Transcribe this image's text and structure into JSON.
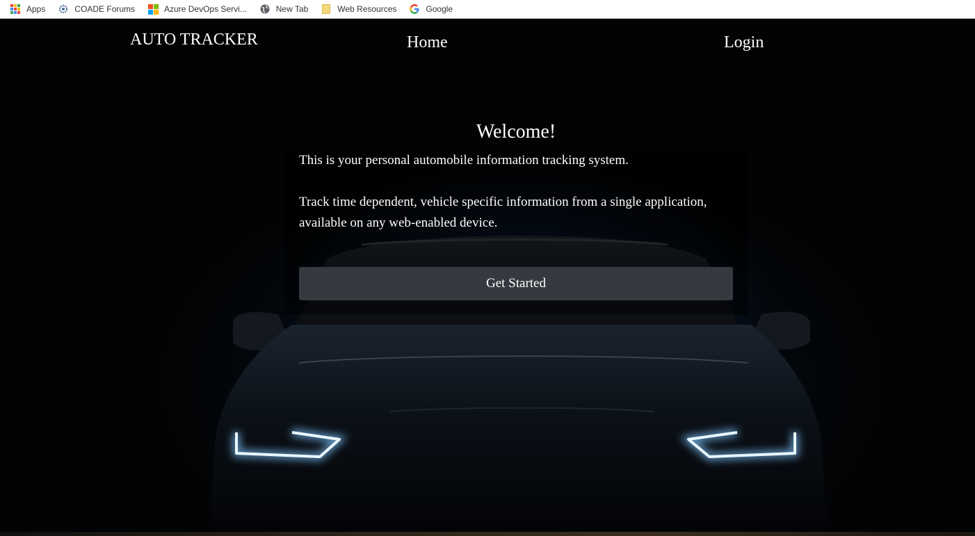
{
  "bookmarks": [
    {
      "label": "Apps",
      "icon": "apps-grid-icon"
    },
    {
      "label": "COADE Forums",
      "icon": "gear-icon"
    },
    {
      "label": "Azure DevOps Servi...",
      "icon": "microsoft-logo-icon"
    },
    {
      "label": "New Tab",
      "icon": "globe-icon"
    },
    {
      "label": "Web Resources",
      "icon": "folder-icon"
    },
    {
      "label": "Google",
      "icon": "google-g-icon"
    }
  ],
  "nav": {
    "brand": "AUTO TRACKER",
    "home": "Home",
    "login": "Login"
  },
  "welcome": {
    "title": "Welcome!",
    "paragraph1": "This is your personal automobile information tracking system.",
    "paragraph2": "Track time dependent, vehicle specific information from a single application, available on any web-enabled device.",
    "button": "Get Started"
  },
  "colors": {
    "background": "#020304",
    "button": "#343a40",
    "text": "#ffffff",
    "headlight": "#dff4ff"
  }
}
